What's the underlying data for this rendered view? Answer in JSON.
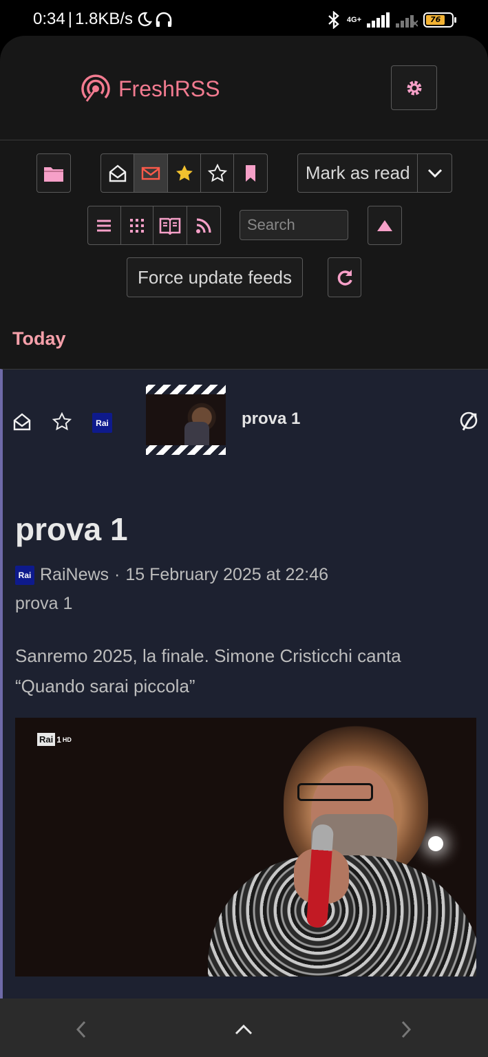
{
  "status_bar": {
    "time": "0:34",
    "speed": "1.8KB/s",
    "network": "4G+",
    "battery": "76"
  },
  "header": {
    "app_name": "FreshRSS"
  },
  "toolbar": {
    "mark_as_read_label": "Mark as read",
    "search_placeholder": "Search",
    "force_update_label": "Force update feeds"
  },
  "section": {
    "title": "Today"
  },
  "article": {
    "row_title": "prova 1",
    "feed_badge": "Rai",
    "title": "prova 1",
    "source": "RaiNews",
    "date": "15 February 2025 at 22:46",
    "subtitle": "prova 1",
    "description": "Sanremo 2025, la finale. Simone Cristicchi canta “Quando sarai piccola”",
    "image_channel_logo": "Rai",
    "image_channel_num": "1",
    "image_channel_hd": "HD"
  },
  "colors": {
    "accent": "#f27b90",
    "today": "#f6a0aa",
    "article_bg": "#1d2130",
    "app_bg": "#171717"
  },
  "icons": [
    "podcast-logo-icon",
    "gear-icon",
    "folder-icon",
    "open-envelope-icon",
    "envelope-icon",
    "star-filled-icon",
    "star-outline-icon",
    "bookmark-icon",
    "chevron-down-icon",
    "list-icon",
    "grid-icon",
    "reader-icon",
    "rss-icon",
    "arrow-up-icon",
    "refresh-icon",
    "link-icon",
    "chevron-left-icon",
    "chevron-up-icon",
    "chevron-right-icon"
  ]
}
